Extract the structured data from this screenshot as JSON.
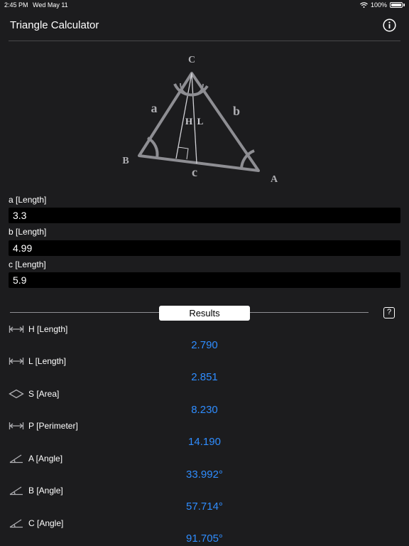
{
  "status_bar": {
    "time": "2:45 PM",
    "date": "Wed May 11",
    "battery": "100%"
  },
  "header": {
    "title": "Triangle Calculator"
  },
  "diagram": {
    "vertex_a": "A",
    "vertex_b": "B",
    "vertex_c": "C",
    "side_a": "a",
    "side_b": "b",
    "side_c": "c",
    "height_label": "H",
    "median_label": "L"
  },
  "inputs": [
    {
      "label": "a [Length]",
      "value": "3.3"
    },
    {
      "label": "b [Length]",
      "value": "4.99"
    },
    {
      "label": "c [Length]",
      "value": "5.9"
    }
  ],
  "results_tab": {
    "label": "Results",
    "help": "?"
  },
  "results": [
    {
      "label": "H [Length]",
      "value": "2.790",
      "icon": "length-icon"
    },
    {
      "label": "L [Length]",
      "value": "2.851",
      "icon": "length-icon"
    },
    {
      "label": "S [Area]",
      "value": "8.230",
      "icon": "area-icon"
    },
    {
      "label": "P [Perimeter]",
      "value": "14.190",
      "icon": "length-icon"
    },
    {
      "label": "A [Angle]",
      "value": "33.992°",
      "icon": "angle-icon"
    },
    {
      "label": "B [Angle]",
      "value": "57.714°",
      "icon": "angle-icon"
    },
    {
      "label": "C [Angle]",
      "value": "91.705°",
      "icon": "angle-icon"
    }
  ],
  "colors": {
    "accent": "#2f8dff",
    "background": "#1c1c1e",
    "input_background": "#000000"
  }
}
